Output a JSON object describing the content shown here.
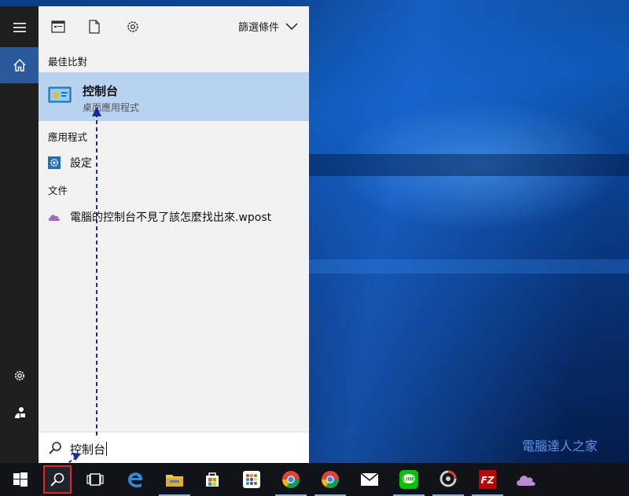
{
  "start_panel": {
    "filter_label": "篩選條件",
    "best_match_header": "最佳比對",
    "best_match": {
      "title": "控制台",
      "subtitle": "桌面應用程式"
    },
    "apps_header": "應用程式",
    "apps": [
      {
        "label": "設定"
      }
    ],
    "docs_header": "文件",
    "docs": [
      {
        "label": "電腦的控制台不見了該怎麼找出來.wpost"
      }
    ],
    "search_value": "控制台"
  },
  "rail": {
    "items": [
      "hamburger-icon",
      "home-icon",
      "settings-icon",
      "user-icon"
    ]
  },
  "taskbar": {
    "items": [
      "windows-start-icon",
      "search-icon",
      "task-view-icon",
      "edge-icon",
      "file-explorer-icon",
      "store-icon",
      "apps-grid-icon",
      "chrome-icon",
      "chrome-alt-icon",
      "mail-icon",
      "line-icon",
      "photo-app-icon",
      "filezilla-icon",
      "onenote-cloud-icon"
    ]
  },
  "watermark": "電腦達人之家",
  "colors": {
    "accent": "#2b5a9c",
    "selection": "#b7d3f0",
    "taskbar": "#101418",
    "highlight": "#e0262b"
  }
}
